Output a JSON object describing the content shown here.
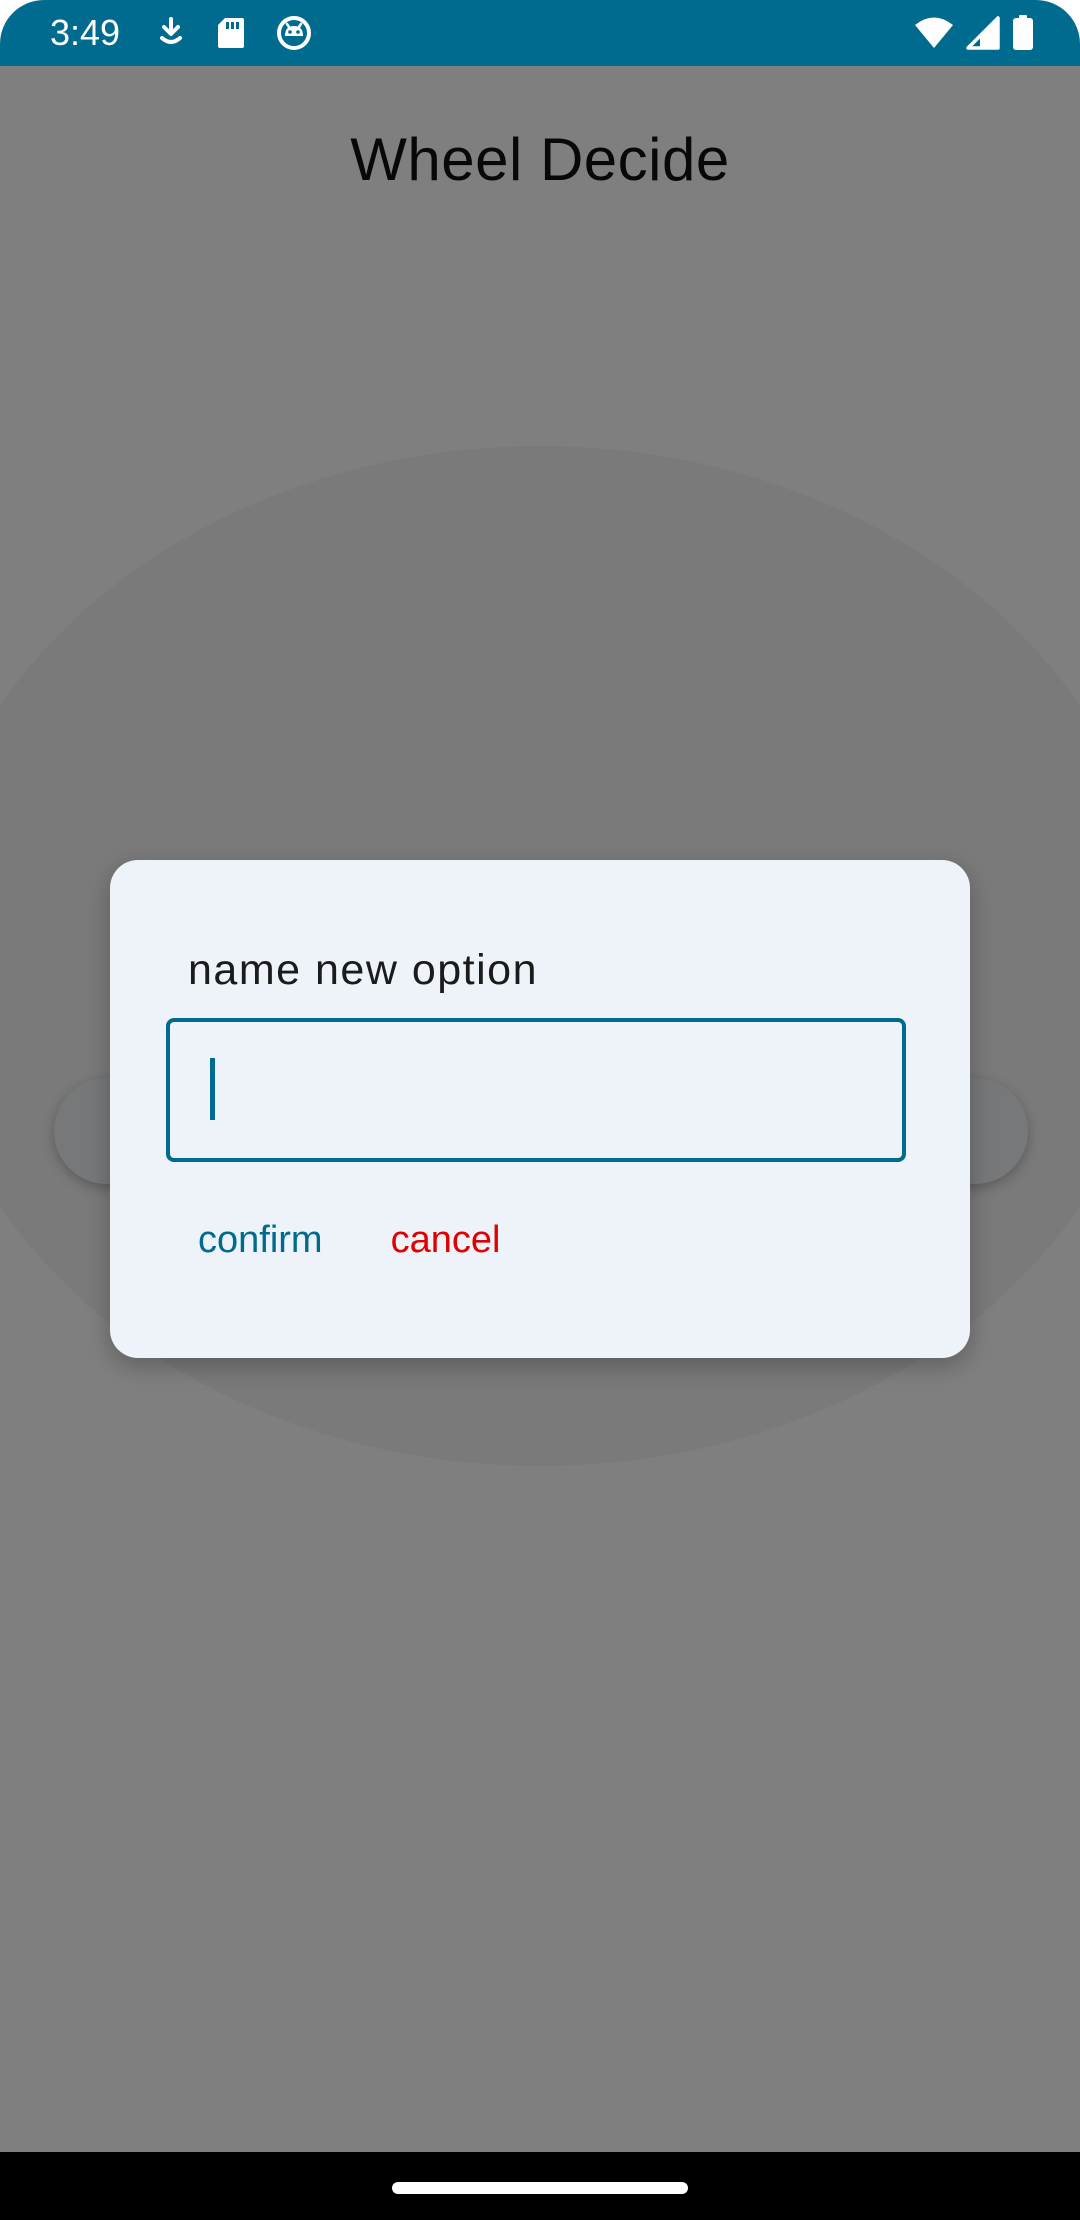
{
  "status_bar": {
    "time": "3:49",
    "left_icons": [
      "download-icon",
      "sd-card-icon",
      "android-debug-icon"
    ],
    "right_icons": [
      "wifi-icon",
      "cell-signal-icon",
      "battery-icon"
    ],
    "background_color": "#006b8f"
  },
  "app": {
    "title": "Wheel Decide"
  },
  "dialog": {
    "title": "name new option",
    "input": {
      "value": "",
      "placeholder": ""
    },
    "confirm_label": "confirm",
    "cancel_label": "cancel",
    "accent_color": "#006b8f",
    "cancel_color": "#e00000"
  },
  "navigation_bar": {
    "icons": [
      "home-handle-icon"
    ]
  }
}
